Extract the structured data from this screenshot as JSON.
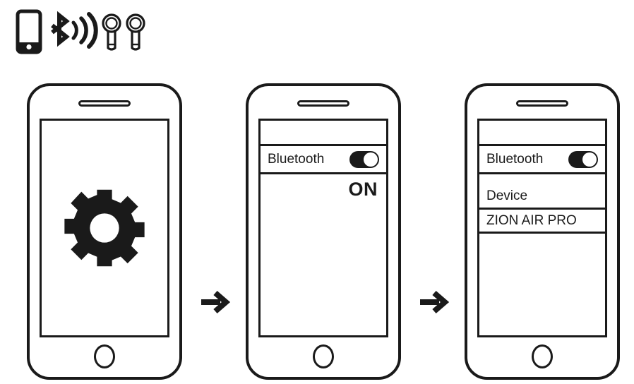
{
  "header_icons": [
    {
      "name": "smartphone-icon",
      "label": "smartphone"
    },
    {
      "name": "bluetooth-icon",
      "label": "bluetooth"
    },
    {
      "name": "signal-waves-icon",
      "label": "signal-waves"
    },
    {
      "name": "earbud-left-icon",
      "label": "earbud-left"
    },
    {
      "name": "earbud-right-icon",
      "label": "earbud-right"
    }
  ],
  "colors": {
    "ink": "#1a1a1a",
    "paper": "#ffffff"
  },
  "steps": [
    {
      "step": "1",
      "screen_icon": "gear-icon",
      "arrow_after": "arrow-right-icon"
    },
    {
      "step": "2",
      "bluetooth_label": "Bluetooth",
      "toggle_state": "on",
      "status_text": "ON",
      "arrow_after": "arrow-right-icon"
    },
    {
      "step": "3",
      "bluetooth_label": "Bluetooth",
      "toggle_state": "on",
      "device_header": "Device",
      "device_name": "ZION AIR PRO"
    }
  ]
}
